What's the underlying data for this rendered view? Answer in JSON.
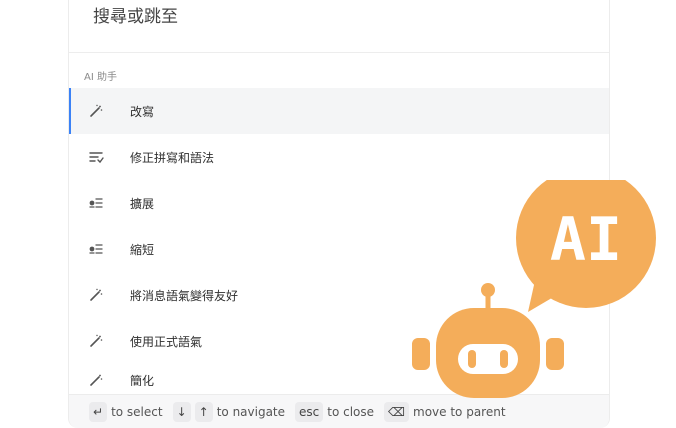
{
  "search": {
    "placeholder": "搜尋或跳至"
  },
  "section": {
    "title": "AI 助手"
  },
  "items": [
    {
      "label": "改寫",
      "icon": "magic-wand-icon",
      "active": true
    },
    {
      "label": "修正拼寫和語法",
      "icon": "text-correct-icon"
    },
    {
      "label": "擴展",
      "icon": "expand-text-icon"
    },
    {
      "label": "縮短",
      "icon": "shorten-text-icon"
    },
    {
      "label": "將消息語氣變得友好",
      "icon": "magic-wand-icon"
    },
    {
      "label": "使用正式語氣",
      "icon": "magic-wand-icon"
    },
    {
      "label": "簡化",
      "icon": "magic-wand-icon"
    }
  ],
  "footer": {
    "select": "to select",
    "navigate": "to navigate",
    "esc_key": "esc",
    "close": "to close",
    "parent": "move to parent"
  },
  "badge": {
    "text": "AI",
    "color": "#f4ad5a"
  },
  "colors": {
    "accent": "#3b82f6",
    "active_bg": "#f4f5f6"
  }
}
